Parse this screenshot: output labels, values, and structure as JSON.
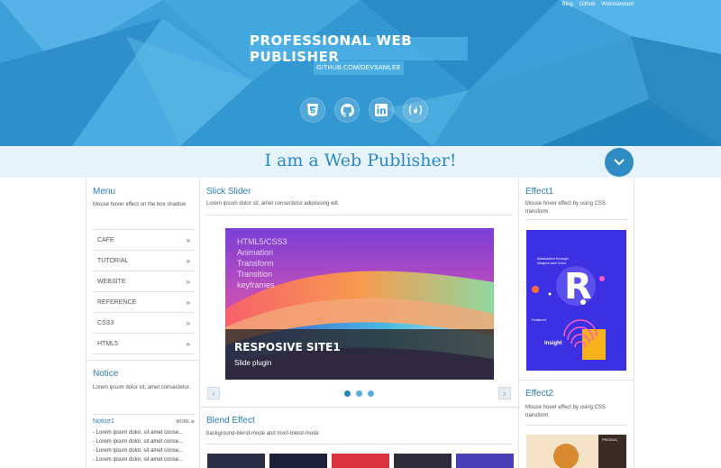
{
  "header": {
    "top_links": [
      "Blog",
      "Github",
      "Webstandard"
    ],
    "title": "PROFESSIONAL WEB PUBLISHER",
    "subtitle": "GITHUB.COM/DEVSAMLEE",
    "socials": [
      {
        "icon": "html5-icon"
      },
      {
        "icon": "github-icon"
      },
      {
        "icon": "linkedin-icon"
      },
      {
        "icon": "freecodecamp-icon"
      }
    ]
  },
  "banner": {
    "text": "I am a Web Publisher!",
    "scroll_icon": "chevron-down-icon"
  },
  "left": {
    "menu_title": "Menu",
    "menu_desc": "Mouse hover effect on the box shadow",
    "menu_items": [
      "CAFE",
      "TUTORIAL",
      "WEBSITE",
      "REFERENCE",
      "CSS3",
      "HTML5"
    ],
    "menu_arrow": "»",
    "notice_title": "Notice",
    "notice_desc": "Lorem ipsum dolor sit, amet consectetur.",
    "notice_sub": "Notice1",
    "notice_more": "MORE ⊕",
    "notice_lines": [
      "- Lorem ipsum dolor, sit amet conse...",
      "- Lorem ipsum dolor, sit amet conse...",
      "- Lorem ipsum dolor, sit amet conse...",
      "- Lorem ipsum dolor, sit amet conse..."
    ]
  },
  "middle": {
    "slick_title": "Slick Slider",
    "slick_desc": "Lorem ipsum dolor sit, amet consectetur adipisicing elit.",
    "slide_lines": [
      "HTML5/CSS3",
      "Animation",
      "Transform",
      "Transition",
      "keyframes"
    ],
    "slide_caption_title": "RESPOSIVE SITE1",
    "slide_caption_sub": "Slide plugin",
    "prev_label": "‹",
    "next_label": "›",
    "dots_count": 3,
    "blend_title": "Blend Effect",
    "blend_desc": "background-blend-mode and mix0-blend-mode"
  },
  "right": {
    "effect1_title": "Effect1",
    "effect1_desc": "Mouse hover effect by using CSS transform.",
    "effect1_img_text": "Abstraction through Shapes and Color",
    "effect1_img_letter": "R",
    "effect1_featured": "Featured",
    "effect1_insight": "Insight",
    "effect2_title": "Effect2",
    "effect2_desc": "Mouse hover effect by using CSS transform.",
    "effect2_img_text": "PRODUC"
  },
  "colors": {
    "header_bg": "#3d9fd6",
    "accent": "#2b7db3",
    "banner_bg": "#e6f3fb",
    "scroll_btn": "#2e8cc2"
  }
}
